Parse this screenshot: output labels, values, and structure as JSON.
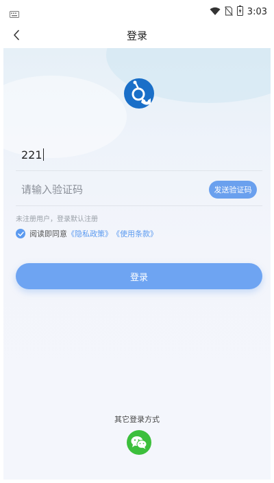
{
  "status_bar": {
    "time": "3:03",
    "icons": [
      "keyboard-icon",
      "wifi-icon",
      "no-sim-icon",
      "battery-icon"
    ]
  },
  "nav": {
    "title": "登录",
    "back_icon": "chevron-left-icon"
  },
  "logo": {
    "icon": "app-logo-icon",
    "color": "#1a6fc8"
  },
  "form": {
    "phone_value": "221",
    "code_placeholder": "请输入验证码",
    "send_code_label": "发送验证码",
    "hint": "未注册用户，登录默认注册",
    "agreement": {
      "checked": true,
      "prefix": "阅读即同意",
      "privacy_link": "《隐私政策》",
      "terms_link": "《使用条款》"
    },
    "login_label": "登录"
  },
  "other_login": {
    "title": "其它登录方式",
    "wechat_icon": "wechat-icon"
  },
  "colors": {
    "accent": "#6ea4f2",
    "link": "#5b9af0",
    "wechat": "#3cbf3c"
  }
}
